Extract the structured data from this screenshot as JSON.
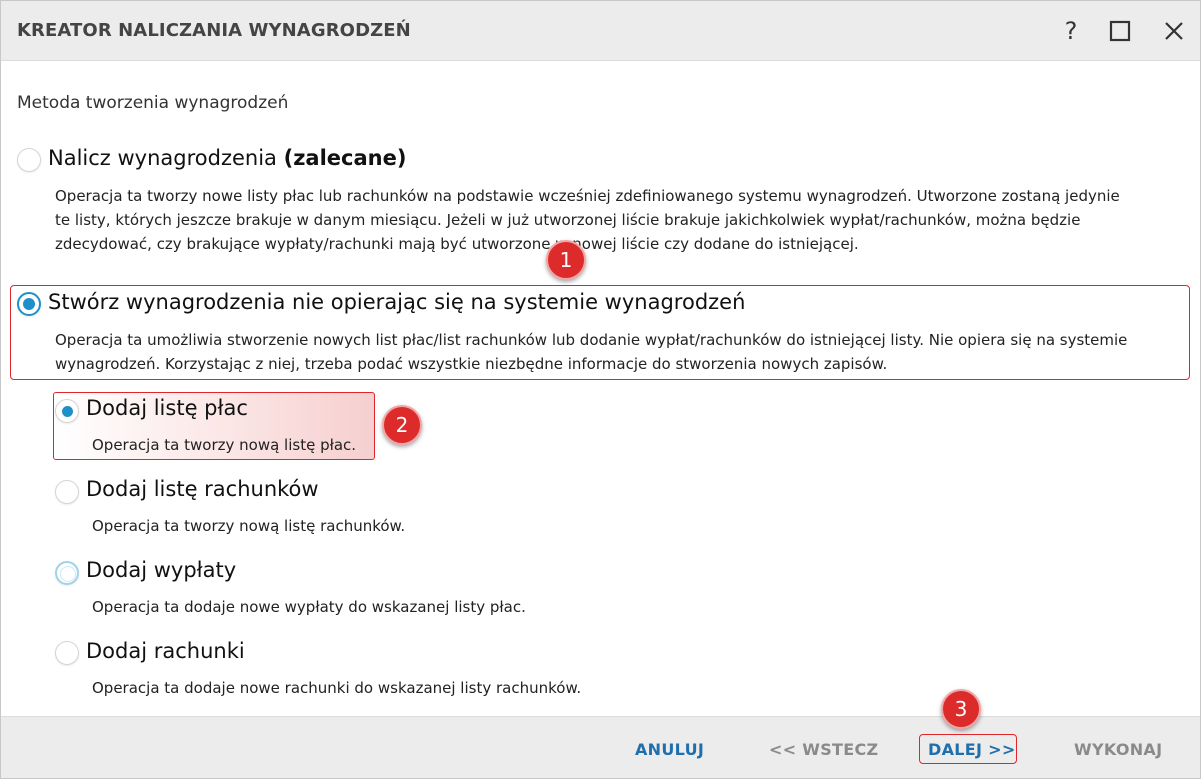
{
  "window": {
    "title": "KREATOR NALICZANIA WYNAGRODZEŃ",
    "help_label": "?"
  },
  "section_label": "Metoda tworzenia wynagrodzeń",
  "options": [
    {
      "title": "Nalicz wynagrodzenia",
      "title_bold": "(zalecane)",
      "desc_lines": [
        "Operacja ta tworzy nowe listy płac lub rachunków na podstawie wcześniej zdefiniowanego systemu wynagrodzeń. Utworzone zostaną jedynie",
        "te listy, których jeszcze brakuje w danym miesiącu. Jeżeli w już utworzonej liście brakuje jakichkolwiek wypłat/rachunków, można będzie",
        "zdecydować, czy brakujące wypłaty/rachunki mają być utworzone w nowej liście czy dodane do istniejącej."
      ],
      "state": "unchecked"
    },
    {
      "title": "Stwórz wynagrodzenia nie opierając się na systemie wynagrodzeń",
      "desc_lines": [
        "Operacja ta umożliwia stworzenie nowych list płac/list rachunków lub dodanie wypłat/rachunków do istniejącej listy. Nie opiera się na systemie",
        "wynagrodzeń. Korzystając z niej, trzeba podać wszystkie niezbędne informacje do stworzenia nowych zapisów."
      ],
      "state": "checked"
    }
  ],
  "sub_options": [
    {
      "title": "Dodaj listę płac",
      "desc": "Operacja ta tworzy nową listę płac.",
      "state": "checked"
    },
    {
      "title": "Dodaj listę rachunków",
      "desc": "Operacja ta tworzy nową listę rachunków.",
      "state": "unchecked"
    },
    {
      "title": "Dodaj wypłaty",
      "desc": "Operacja ta dodaje nowe wypłaty do wskazanej listy płac.",
      "state": "focused"
    },
    {
      "title": "Dodaj rachunki",
      "desc": "Operacja ta dodaje nowe rachunki do wskazanej listy rachunków.",
      "state": "unchecked"
    }
  ],
  "badges": [
    "1",
    "2",
    "3"
  ],
  "footer": {
    "cancel": "ANULUJ",
    "back": "<< WSTECZ",
    "next": "DALEJ >>",
    "execute": "WYKONAJ"
  },
  "colors": {
    "accent": "#1e90c8",
    "primary_button": "#1f6fad",
    "disabled_button": "#8a8a8a",
    "annotation_red": "#e0262a"
  }
}
